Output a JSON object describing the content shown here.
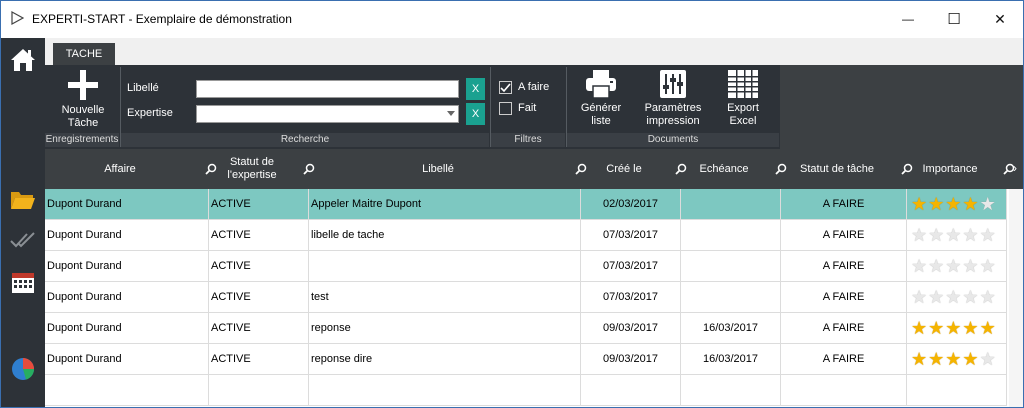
{
  "window": {
    "title": "EXPERTI-START - Exemplaire de démonstration",
    "min_glyph": "—",
    "max_glyph": "☐",
    "close_glyph": "✕"
  },
  "sidebar": {
    "icons": [
      "home-icon",
      "folder-icon",
      "double-check-icon",
      "calendar-icon",
      "pie-chart-icon"
    ]
  },
  "ribbon": {
    "tab_label": "TACHE",
    "new_task_label_1": "Nouvelle",
    "new_task_label_2": "Tâche",
    "group_enregistrements": "Enregistrements",
    "libelle_label": "Libellé",
    "expertise_label": "Expertise",
    "libelle_value": "",
    "expertise_value": "",
    "clear_label": "X",
    "group_recherche": "Recherche",
    "filter_a_faire": "A faire",
    "filter_fait": "Fait",
    "filter_a_faire_checked": true,
    "filter_fait_checked": false,
    "group_filtres": "Filtres",
    "generer_1": "Générer",
    "generer_2": "liste",
    "parametres_1": "Paramètres",
    "parametres_2": "impression",
    "export_1": "Export",
    "export_2": "Excel",
    "group_documents": "Documents"
  },
  "grid": {
    "columns": [
      {
        "label": "Affaire"
      },
      {
        "label": "Statut de\nl'expertise"
      },
      {
        "label": "Libellé"
      },
      {
        "label": "Créé le"
      },
      {
        "label": "Echéance"
      },
      {
        "label": "Statut de tâche"
      },
      {
        "label": "Importance"
      }
    ],
    "rows": [
      {
        "affaire": "Dupont Durand",
        "statut": "ACTIVE",
        "libelle": "Appeler Maitre Dupont",
        "cree": "02/03/2017",
        "echeance": "",
        "statut_tache": "A FAIRE",
        "importance": 4,
        "selected": true
      },
      {
        "affaire": "Dupont Durand",
        "statut": "ACTIVE",
        "libelle": "libelle de tache",
        "cree": "07/03/2017",
        "echeance": "",
        "statut_tache": "A FAIRE",
        "importance": 0,
        "selected": false
      },
      {
        "affaire": "Dupont Durand",
        "statut": "ACTIVE",
        "libelle": "",
        "cree": "07/03/2017",
        "echeance": "",
        "statut_tache": "A FAIRE",
        "importance": 0,
        "selected": false
      },
      {
        "affaire": "Dupont Durand",
        "statut": "ACTIVE",
        "libelle": "test",
        "cree": "07/03/2017",
        "echeance": "",
        "statut_tache": "A FAIRE",
        "importance": 0,
        "selected": false
      },
      {
        "affaire": "Dupont Durand",
        "statut": "ACTIVE",
        "libelle": "reponse",
        "cree": "09/03/2017",
        "echeance": "16/03/2017",
        "statut_tache": "A FAIRE",
        "importance": 5,
        "selected": false
      },
      {
        "affaire": "Dupont Durand",
        "statut": "ACTIVE",
        "libelle": "reponse dire",
        "cree": "09/03/2017",
        "echeance": "16/03/2017",
        "statut_tache": "A FAIRE",
        "importance": 4,
        "selected": false
      }
    ],
    "importance_max": 5
  },
  "colors": {
    "selected_row": "#7dc8c1",
    "accent_button": "#1aa190",
    "ribbon_bg": "#2d3238",
    "star_full": "#f5b400"
  }
}
